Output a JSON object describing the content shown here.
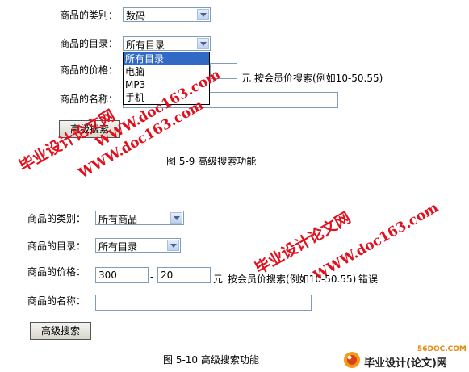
{
  "form1": {
    "category_label": "商品的类别：",
    "category_value": "数码",
    "catalog_label": "商品的目录：",
    "catalog_value": "所有目录",
    "catalog_options": [
      "所有目录",
      "电脑",
      "MP3",
      "手机"
    ],
    "price_label": "商品的价格：",
    "price_unit": "元",
    "price_hint": "按会员价搜索(例如10-50.55)",
    "name_label": "商品的名称：",
    "search_button": "高级搜索",
    "caption": "图 5-9  高级搜索功能"
  },
  "form2": {
    "category_label": "商品的类别：",
    "category_value": "所有商品",
    "catalog_label": "商品的目录：",
    "catalog_value": "所有目录",
    "price_label": "商品的价格：",
    "price_min": "300",
    "price_sep": "-",
    "price_max": "20",
    "price_unit": "元",
    "price_hint": "按会员价搜索(例如10-50.55)",
    "error_text": "错误",
    "name_label": "商品的名称：",
    "search_button": "高级搜索",
    "caption": "图 5-10 高级搜索功能"
  },
  "watermarks": {
    "cn_text": "毕业设计论文网",
    "url_text": "WWW.doc163.com",
    "site_url": "56DOC.COM",
    "site_name": "毕业设计(论文)网",
    "color": "#e0101e"
  }
}
